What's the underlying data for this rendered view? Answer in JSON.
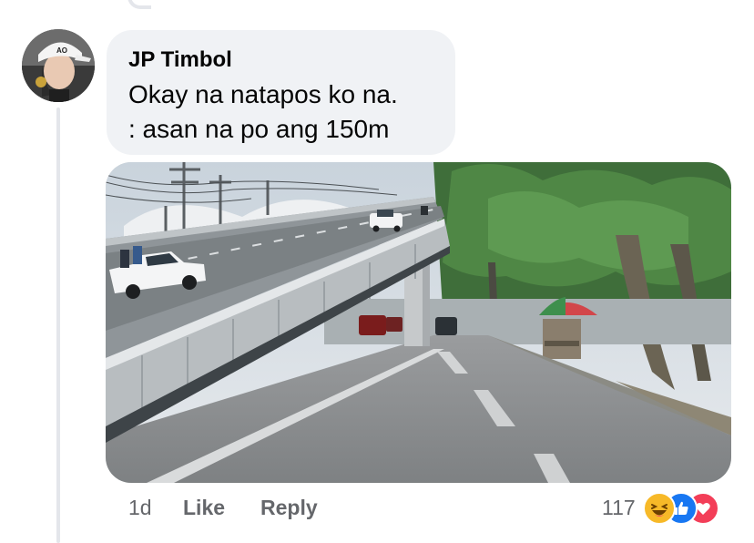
{
  "comment": {
    "author": "JP Timbol",
    "text_line1": "Okay na natapos ko na.",
    "text_line2": ": asan na po ang 150m",
    "time": "1d",
    "like_label": "Like",
    "reply_label": "Reply",
    "reaction_count": "117",
    "reactions": [
      "haha-icon",
      "like-icon",
      "love-icon"
    ]
  },
  "avatar": {
    "cap_text": "AO"
  },
  "colors": {
    "bubble": "#f0f2f5",
    "muted_text": "#65676b",
    "thread_line": "#e4e6eb",
    "like_blue": "#1877f2",
    "love_red": "#f33e58",
    "haha_yellow": "#f7b928"
  }
}
